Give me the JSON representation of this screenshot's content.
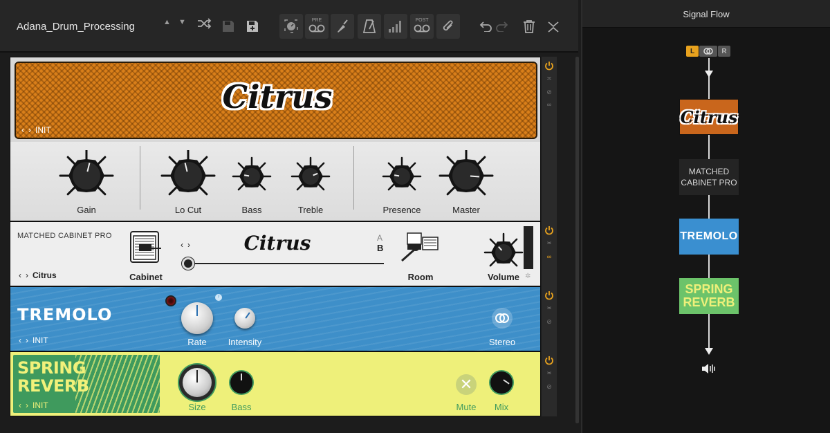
{
  "toolbar": {
    "preset_name": "Adana_Drum_Processing",
    "pre_label": "PRE",
    "post_label": "POST"
  },
  "amp": {
    "name": "Citrus",
    "preset": "INIT",
    "knobs": [
      {
        "label": "Gain",
        "level": 0.55
      },
      {
        "label": "Lo Cut",
        "level": 0.45
      },
      {
        "label": "Bass",
        "level": 0.2
      },
      {
        "label": "Treble",
        "level": 0.75
      },
      {
        "label": "Presence",
        "level": 0.2
      },
      {
        "label": "Master",
        "level": 0.85
      }
    ]
  },
  "cabinet": {
    "title": "MATCHED CABINET PRO",
    "preset": "Citrus",
    "name": "Citrus",
    "cabinet_label": "Cabinet",
    "room_label": "Room",
    "volume_label": "Volume",
    "ab_a": "A",
    "ab_b": "B"
  },
  "tremolo": {
    "name": "TREMOLO",
    "preset": "INIT",
    "rate_label": "Rate",
    "intensity_label": "Intensity",
    "stereo_label": "Stereo"
  },
  "spring": {
    "name_line1": "SPRING",
    "name_line2": "REVERB",
    "preset": "INIT",
    "size_label": "Size",
    "bass_label": "Bass",
    "mute_label": "Mute",
    "mix_label": "Mix"
  },
  "signal_flow": {
    "title": "Signal Flow",
    "l": "L",
    "r": "R",
    "blocks": {
      "citrus": "Citrus",
      "cab_line1": "MATCHED",
      "cab_line2": "CABINET PRO",
      "tremolo": "TREMOLO",
      "spring1": "SPRING",
      "spring2": "REVERB"
    }
  },
  "colors": {
    "power": "#e8a21e",
    "amp_orange": "#d97f1a",
    "tremolo_blue": "#3e8fc9",
    "spring_yellow": "#eef07a",
    "spring_green": "#3f9a5d",
    "flow_citrus": "#c9661c",
    "flow_tremolo": "#3a8fd0",
    "flow_spring": "#6cc36a"
  }
}
